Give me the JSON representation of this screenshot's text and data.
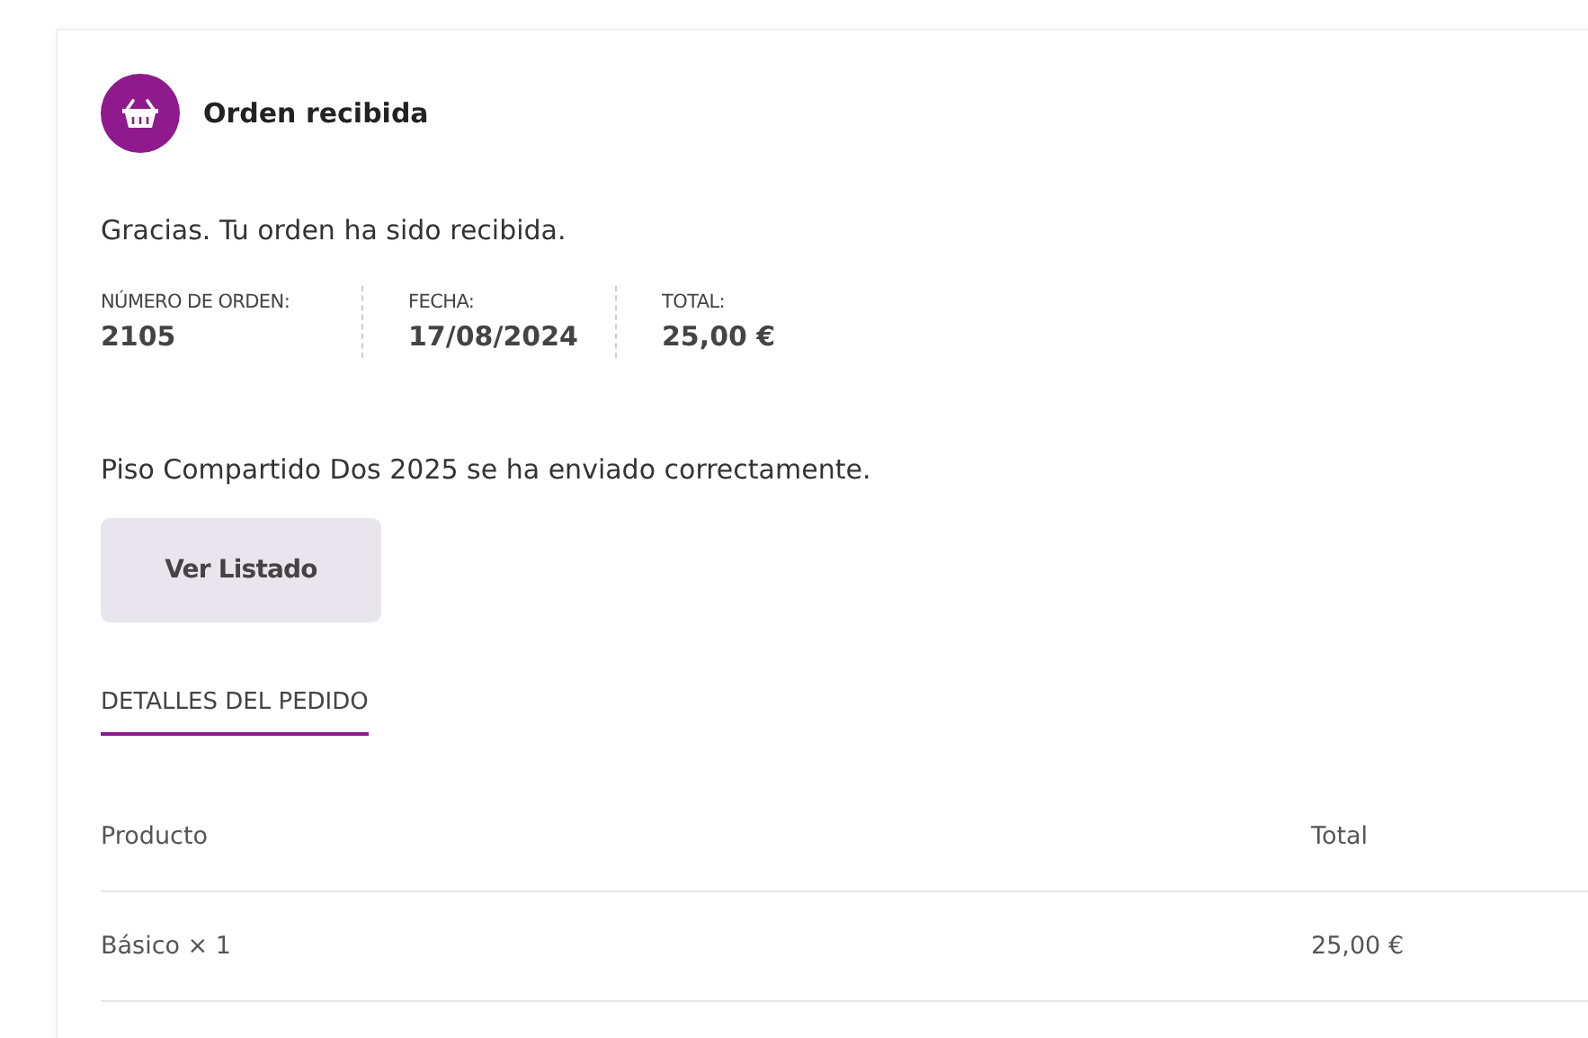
{
  "order": {
    "title": "Orden recibida",
    "thanks": "Gracias. Tu orden ha sido recibida.",
    "overview": [
      {
        "label": "NÚMERO DE ORDEN:",
        "value": "2105"
      },
      {
        "label": "FECHA:",
        "value": "17/08/2024"
      },
      {
        "label": "TOTAL:",
        "value": "25,00 €"
      }
    ],
    "notice": "Piso Compartido Dos 2025 se ha enviado correctamente.",
    "button": "Ver Listado"
  },
  "tabs": [
    {
      "label": "DETALLES DEL PEDIDO",
      "selected": true
    }
  ],
  "table": {
    "columns": [
      "Producto",
      "Total"
    ],
    "rows": [
      [
        "Básico × 1",
        "25,00 €"
      ]
    ]
  }
}
